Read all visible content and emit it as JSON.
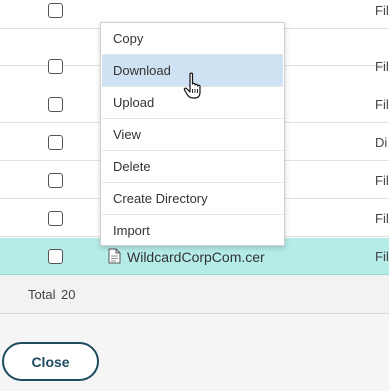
{
  "rows": [
    {
      "type": "Fil",
      "selected": false
    },
    {
      "type": "Fil",
      "selected": false
    },
    {
      "type": "Fil",
      "selected": false
    },
    {
      "type": "Di",
      "selected": false
    },
    {
      "type": "Fil",
      "selected": false
    },
    {
      "type": "Fil",
      "selected": false
    },
    {
      "type": "Fil",
      "selected": true,
      "name": "WildcardCorpCom.cer"
    }
  ],
  "footer": {
    "total_label": "Total",
    "total_count": "20"
  },
  "context_menu": {
    "items": [
      "Copy",
      "Download",
      "Upload",
      "View",
      "Delete",
      "Create Directory",
      "Import"
    ],
    "hovered": "Download"
  },
  "close_label": "Close",
  "icons": {
    "file": "file-icon",
    "cursor": "hand-pointer-icon"
  },
  "colors": {
    "selected_row": "#b5ece8",
    "menu_hover": "#cfe2f3",
    "close_border": "#1d4c5e"
  }
}
